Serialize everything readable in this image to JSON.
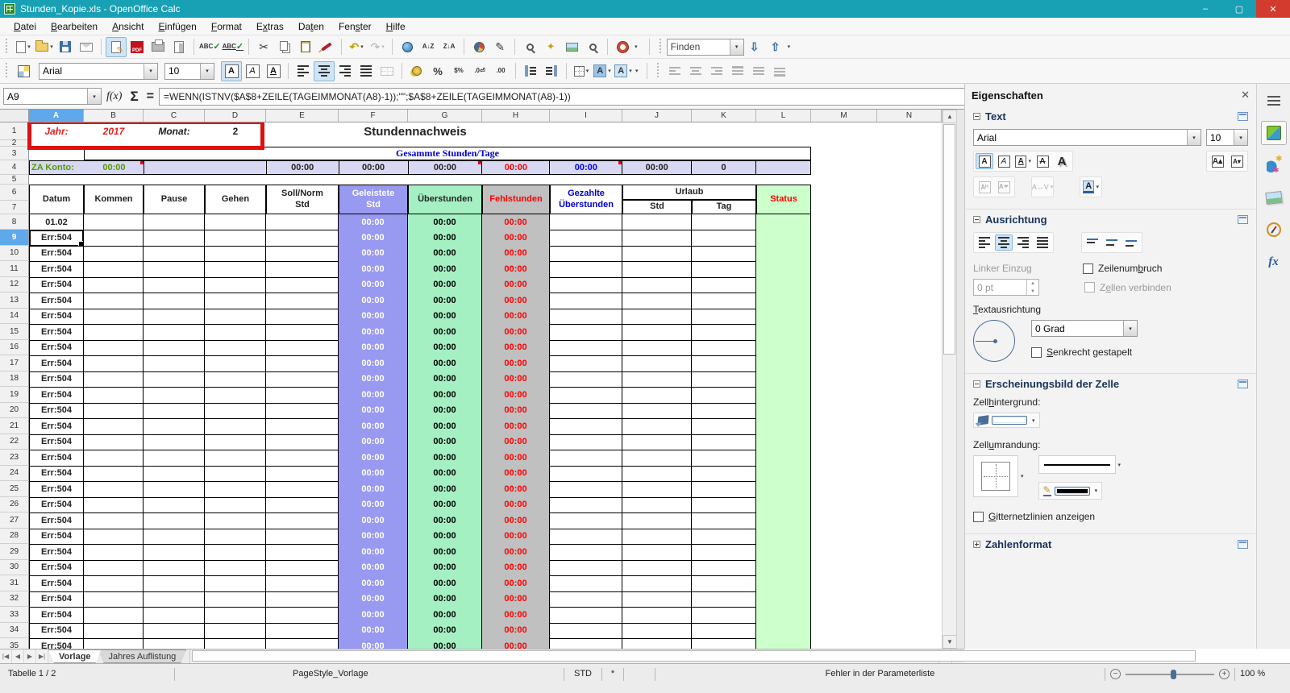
{
  "window": {
    "title": "Stunden_Kopie.xls - OpenOffice Calc",
    "minimize": "–",
    "maximize": "▢",
    "close": "✕"
  },
  "menu": {
    "items": [
      {
        "label": "Datei",
        "accel": 0
      },
      {
        "label": "Bearbeiten",
        "accel": 0
      },
      {
        "label": "Ansicht",
        "accel": 0
      },
      {
        "label": "Einfügen",
        "accel": 0
      },
      {
        "label": "Format",
        "accel": 0
      },
      {
        "label": "Extras",
        "accel": 1
      },
      {
        "label": "Daten",
        "accel": 2
      },
      {
        "label": "Fenster",
        "accel": 3
      },
      {
        "label": "Hilfe",
        "accel": 0
      }
    ]
  },
  "toolbar": {
    "pdf_label": "PDF",
    "spell_label": "ABC",
    "autospell_label": "ABC",
    "sort_az": "A↓Z",
    "sort_za": "Z↓A",
    "undo_glyph": "↶",
    "redo_glyph": "↷",
    "cut_glyph": "✂",
    "draw_glyph": "✎",
    "nav_glyph": "✦",
    "percent_label": "%",
    "stdformat_label": "$%",
    "adddec_label": ".0⏎",
    "deldec_label": ".00"
  },
  "find_toolbar": {
    "text": "Finden",
    "down_glyph": "⇩",
    "up_glyph": "⇧"
  },
  "format_toolbar": {
    "font_name": "Arial",
    "font_size": "10",
    "bold": "A",
    "italic": "A",
    "underline": "A"
  },
  "formula_bar": {
    "cell_reference": "A9",
    "fx": "f(x)",
    "sum": "Σ",
    "equals": "=",
    "formula": "=WENN(ISTNV($A$8+ZEILE(TAGEIMMONAT(A8)-1));\"\";$A$8+ZEILE(TAGEIMMONAT(A8)-1))"
  },
  "sheet": {
    "column_letters": [
      "A",
      "B",
      "C",
      "D",
      "E",
      "F",
      "G",
      "H",
      "I",
      "J",
      "K",
      "L",
      "M",
      "N"
    ],
    "selected_column": "A",
    "selected_row": 9,
    "selected_cell": "A9",
    "info_row": {
      "jahr_label": "Jahr:",
      "jahr_value": "2017",
      "monat_label": "Monat:",
      "monat_value": "2"
    },
    "title": "Stundennachweis",
    "summary_header": "Gesammte Stunden/Tage",
    "za_row": {
      "label": "ZA Konto:",
      "value": "00:00",
      "e": "00:00",
      "f": "00:00",
      "g": "00:00",
      "h": "00:00",
      "i": "00:00",
      "j": "00:00",
      "k": "0"
    },
    "table_headers": {
      "datum": "Datum",
      "kommen": "Kommen",
      "pause": "Pause",
      "gehen": "Gehen",
      "soll_line1": "Soll/Norm",
      "soll_line2": "Std",
      "geleistete_line1": "Geleistete",
      "geleistete_line2": "Std",
      "ueberstunden": "Überstunden",
      "fehlstunden": "Fehlstunden",
      "gezahlte_line1": "Gezahlte",
      "gezahlte_line2": "Überstunden",
      "urlaub": "Urlaub",
      "urlaub_std": "Std",
      "urlaub_tag": "Tag",
      "status": "Status"
    },
    "first_data_row": {
      "row": 8,
      "datum": "01.02",
      "geleistete": "00:00",
      "ueberstunden": "00:00",
      "fehlstunden": "00:00"
    },
    "error_rows": {
      "from": 9,
      "to": 35,
      "datum": "Err:504",
      "geleistete": "00:00",
      "ueberstunden": "00:00",
      "fehlstunden": "00:00"
    }
  },
  "tabs": {
    "active": "Vorlage",
    "other": "Jahres Auflistung"
  },
  "status_bar": {
    "sheet_info": "Tabelle 1 / 2",
    "page_style": "PageStyle_Vorlage",
    "mode": "STD",
    "modified": "*",
    "message": "Fehler in der Parameterliste",
    "zoom_level": "100 %"
  },
  "sidebar": {
    "panel_title": "Eigenschaften",
    "close": "✕",
    "text_section": {
      "title": "Text",
      "font_name": "Arial",
      "font_size": "10"
    },
    "alignment_section": {
      "title": "Ausrichtung",
      "left_indent": {
        "label": "Linker Einzug",
        "accel": -1
      },
      "indent_value": "0 pt",
      "wrap": {
        "label": "Zeilenumbruch",
        "accel": 8
      },
      "merge": {
        "label": "Zellen verbinden",
        "accel": 1
      },
      "text_orientation": {
        "label": "Textausrichtung",
        "accel": 0
      },
      "rotation_value": "0 Grad",
      "stacked": {
        "label": "Senkrecht gestapelt",
        "accel": 0
      }
    },
    "appearance_section": {
      "title": "Erscheinungsbild der Zelle",
      "background": {
        "label": "Zellhintergrund:",
        "accel": 4
      },
      "border": {
        "label": "Zellumrandung:",
        "accel": 4
      },
      "gridlines": {
        "label": "Gitternetzlinien anzeigen",
        "accel": 0
      }
    },
    "numberformat_section": {
      "title": "Zahlenformat"
    }
  },
  "colors": {
    "titlebar": "#18a0b4",
    "purple": "#9899f0",
    "mint": "#a5f0c3",
    "gray": "#c0c0c0",
    "lavender": "#d8d8f2",
    "statusgreen": "#ccffcc",
    "selection_header": "#5fa8ea",
    "red": "#ff0000",
    "blue": "#0000ff",
    "green_label": "#559900",
    "annotation_red": "#dd1111"
  }
}
